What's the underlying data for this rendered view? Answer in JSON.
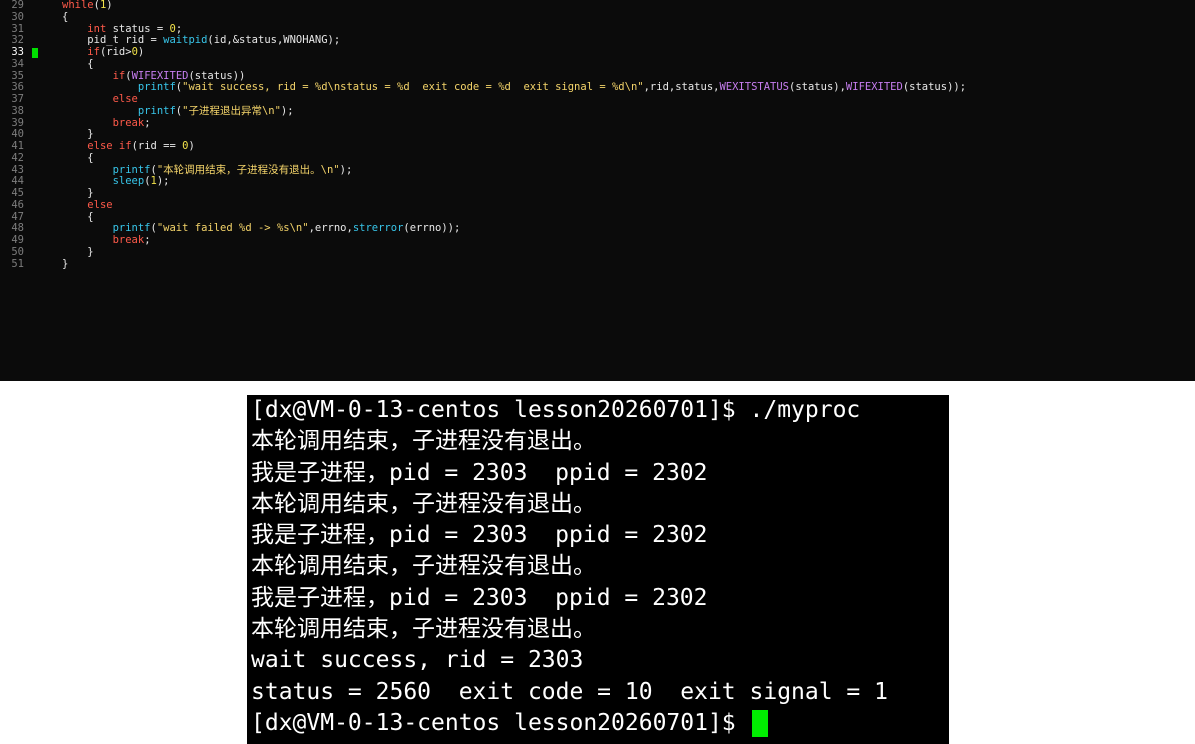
{
  "editor": {
    "lines": [
      {
        "num": "29",
        "indent": 0,
        "segments": [
          [
            "kw",
            "while"
          ],
          [
            "pl",
            "("
          ],
          [
            "nm",
            "1"
          ],
          [
            "pl",
            ")"
          ]
        ]
      },
      {
        "num": "30",
        "indent": 0,
        "segments": [
          [
            "pl",
            "{"
          ]
        ]
      },
      {
        "num": "31",
        "indent": 1,
        "segments": [
          [
            "ty",
            "int"
          ],
          [
            "pl",
            " status = "
          ],
          [
            "nm",
            "0"
          ],
          [
            "pl",
            ";"
          ]
        ]
      },
      {
        "num": "32",
        "indent": 1,
        "segments": [
          [
            "pl",
            "pid_t rid = "
          ],
          [
            "fn",
            "waitpid"
          ],
          [
            "pl",
            "(id,&status,WNOHANG);"
          ]
        ]
      },
      {
        "num": "33",
        "indent": 1,
        "current": true,
        "segments": [
          [
            "kw",
            "if"
          ],
          [
            "pl",
            "(rid>"
          ],
          [
            "nm",
            "0"
          ],
          [
            "pl",
            ")"
          ]
        ]
      },
      {
        "num": "34",
        "indent": 1,
        "segments": [
          [
            "pl",
            "{"
          ]
        ]
      },
      {
        "num": "35",
        "indent": 2,
        "segments": [
          [
            "kw",
            "if"
          ],
          [
            "pl",
            "("
          ],
          [
            "mc",
            "WIFEXITED"
          ],
          [
            "pl",
            "(status))"
          ]
        ]
      },
      {
        "num": "36",
        "indent": 3,
        "segments": [
          [
            "fn",
            "printf"
          ],
          [
            "pl",
            "("
          ],
          [
            "st",
            "\"wait success, rid = %d\\nstatus = %d  exit code = %d  exit signal = %d\\n\""
          ],
          [
            "pl",
            ",rid,status,"
          ],
          [
            "mc",
            "WEXITSTATUS"
          ],
          [
            "pl",
            "(status),"
          ],
          [
            "mc",
            "WIFEXITED"
          ],
          [
            "pl",
            "(status));"
          ]
        ]
      },
      {
        "num": "37",
        "indent": 2,
        "segments": [
          [
            "kw",
            "else"
          ]
        ]
      },
      {
        "num": "38",
        "indent": 3,
        "segments": [
          [
            "fn",
            "printf"
          ],
          [
            "pl",
            "("
          ],
          [
            "st",
            "\"子进程退出异常\\n\""
          ],
          [
            "pl",
            ");"
          ]
        ]
      },
      {
        "num": "39",
        "indent": 2,
        "segments": [
          [
            "kw",
            "break"
          ],
          [
            "pl",
            ";"
          ]
        ]
      },
      {
        "num": "40",
        "indent": 1,
        "segments": [
          [
            "pl",
            "}"
          ]
        ]
      },
      {
        "num": "41",
        "indent": 1,
        "segments": [
          [
            "kw",
            "else if"
          ],
          [
            "pl",
            "(rid == "
          ],
          [
            "nm",
            "0"
          ],
          [
            "pl",
            ")"
          ]
        ]
      },
      {
        "num": "42",
        "indent": 1,
        "segments": [
          [
            "pl",
            "{"
          ]
        ]
      },
      {
        "num": "43",
        "indent": 2,
        "segments": [
          [
            "fn",
            "printf"
          ],
          [
            "pl",
            "("
          ],
          [
            "st",
            "\"本轮调用结束，子进程没有退出。\\n\""
          ],
          [
            "pl",
            ");"
          ]
        ]
      },
      {
        "num": "44",
        "indent": 2,
        "segments": [
          [
            "fn",
            "sleep"
          ],
          [
            "pl",
            "("
          ],
          [
            "nm",
            "1"
          ],
          [
            "pl",
            ");"
          ]
        ]
      },
      {
        "num": "45",
        "indent": 1,
        "segments": [
          [
            "pl",
            "}"
          ]
        ]
      },
      {
        "num": "46",
        "indent": 1,
        "segments": [
          [
            "kw",
            "else"
          ]
        ]
      },
      {
        "num": "47",
        "indent": 1,
        "segments": [
          [
            "pl",
            "{"
          ]
        ]
      },
      {
        "num": "48",
        "indent": 2,
        "segments": [
          [
            "fn",
            "printf"
          ],
          [
            "pl",
            "("
          ],
          [
            "st",
            "\"wait failed %d -> %s\\n\""
          ],
          [
            "pl",
            ",errno,"
          ],
          [
            "fn",
            "strerror"
          ],
          [
            "pl",
            "(errno));"
          ]
        ]
      },
      {
        "num": "49",
        "indent": 2,
        "segments": [
          [
            "kw",
            "break"
          ],
          [
            "pl",
            ";"
          ]
        ]
      },
      {
        "num": "50",
        "indent": 1,
        "segments": [
          [
            "pl",
            "}"
          ]
        ]
      },
      {
        "num": "51",
        "indent": 0,
        "segments": [
          [
            "pl",
            "}"
          ]
        ]
      }
    ]
  },
  "terminal": {
    "lines": [
      "[dx@VM-0-13-centos lesson20260701]$ ./myproc",
      "本轮调用结束，子进程没有退出。",
      "我是子进程，pid = 2303  ppid = 2302",
      "本轮调用结束，子进程没有退出。",
      "我是子进程，pid = 2303  ppid = 2302",
      "本轮调用结束，子进程没有退出。",
      "我是子进程，pid = 2303  ppid = 2302",
      "本轮调用结束，子进程没有退出。",
      "wait success, rid = 2303",
      "status = 2560  exit code = 10  exit signal = 1"
    ],
    "prompt": "[dx@VM-0-13-centos lesson20260701]$ "
  },
  "colors": {
    "editor_bg": "#0b0b0b",
    "keyword": "#ff5a4a",
    "number": "#f2e24a",
    "string": "#f4d46a",
    "function": "#38c6ea",
    "macro": "#c77ef0",
    "terminal_bg": "#000000",
    "cursor": "#00ee00"
  }
}
